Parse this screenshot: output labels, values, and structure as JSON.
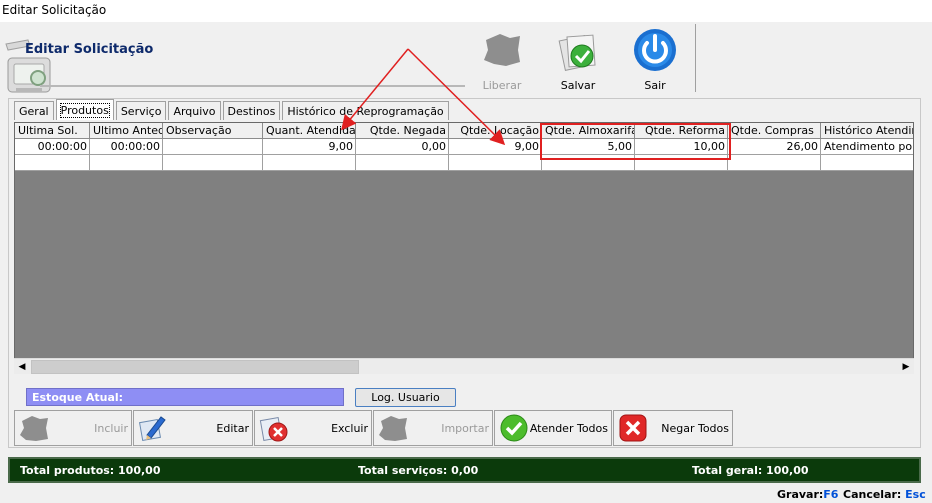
{
  "window": {
    "title": "Editar Solicitação"
  },
  "header": {
    "title": "Editar Solicitação"
  },
  "toolbar": {
    "liberar_label": "Liberar",
    "salvar_label": "Salvar",
    "sair_label": "Sair"
  },
  "tabs": [
    {
      "label": "Geral"
    },
    {
      "label": "Produtos"
    },
    {
      "label": "Serviço"
    },
    {
      "label": "Arquivo"
    },
    {
      "label": "Destinos"
    },
    {
      "label": "Histórico de Reprogramação"
    }
  ],
  "grid": {
    "columns": [
      "Ultima Sol.",
      "Ultimo Anted.",
      "Observação",
      "Quant. Atendida",
      "Qtde. Negada",
      "Qtde. Locação",
      "Qtde. Almoxarifado",
      "Qtde. Reforma",
      "Qtde. Compras",
      "Histórico Atendime"
    ],
    "rows": [
      [
        "00:00:00",
        "00:00:00",
        "",
        "9,00",
        "0,00",
        "9,00",
        "5,00",
        "10,00",
        "26,00",
        "Atendimento por lo"
      ]
    ]
  },
  "estoque": {
    "label": "Estoque Atual:"
  },
  "log_usuario_label": "Log. Usuario",
  "actions": {
    "incluir_label": "Incluir",
    "editar_label": "Editar",
    "excluir_label": "Excluir",
    "importar_label": "Importar",
    "atender_label": "Atender Todos",
    "negar_label": "Negar Todos"
  },
  "totals": {
    "produtos": "Total produtos: 100,00",
    "servicos": "Total serviços: 0,00",
    "geral": "Total geral: 100,00"
  },
  "shortcuts": {
    "gravar_label": "Gravar:",
    "gravar_key": "F6",
    "cancelar_label": "Cancelar:",
    "cancelar_key": "Esc"
  },
  "colors": {
    "totals_bg": "#0b3a0b",
    "estoque_bg": "#8e8ef4",
    "annotation_red": "#e02020",
    "grid_bg": "#808080"
  }
}
